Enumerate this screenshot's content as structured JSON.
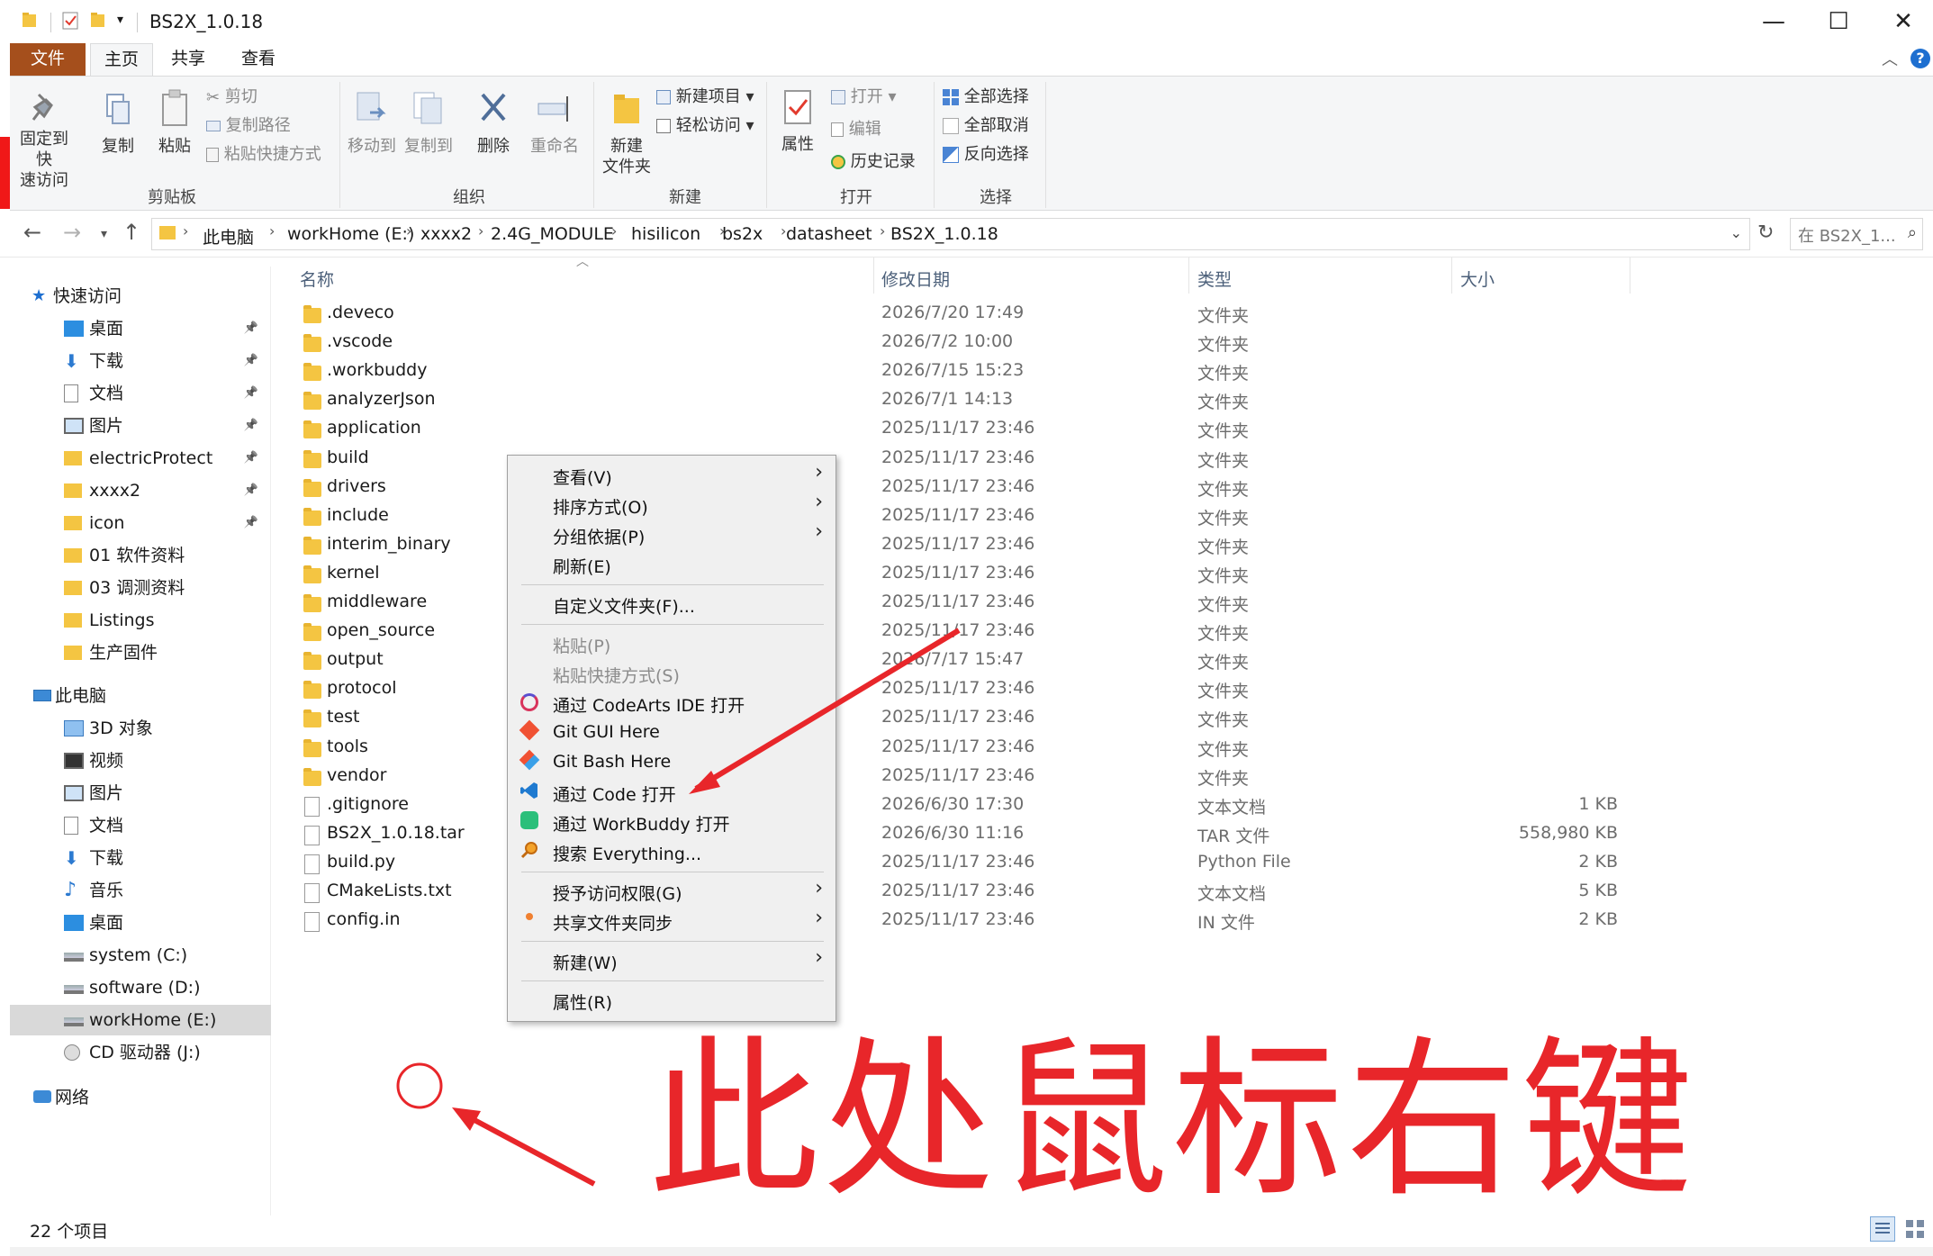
{
  "window": {
    "title": "BS2X_1.0.18",
    "minimize": "—",
    "maximize": "☐",
    "close": "✕"
  },
  "tabs": [
    {
      "label": "文件"
    },
    {
      "label": "主页"
    },
    {
      "label": "共享"
    },
    {
      "label": "查看"
    }
  ],
  "ribbon": {
    "clipboard": {
      "pin_label_1": "固定到快",
      "pin_label_2": "速访问",
      "copy": "复制",
      "paste": "粘贴",
      "cut": "剪切",
      "copy_path": "复制路径",
      "paste_shortcut": "粘贴快捷方式",
      "group": "剪贴板"
    },
    "organize": {
      "move_to": "移动到",
      "copy_to": "复制到",
      "delete": "删除",
      "rename": "重命名",
      "group": "组织"
    },
    "new": {
      "new_folder_1": "新建",
      "new_folder_2": "文件夹",
      "new_item": "新建项目 ▾",
      "easy_access": "轻松访问 ▾",
      "group": "新建"
    },
    "open": {
      "properties": "属性",
      "open": "打开 ▾",
      "edit": "编辑",
      "history": "历史记录",
      "group": "打开"
    },
    "select": {
      "select_all": "全部选择",
      "select_none": "全部取消",
      "invert": "反向选择",
      "group": "选择"
    }
  },
  "address": {
    "crumbs": [
      "此电脑",
      "workHome (E:)",
      "xxxx2",
      "2.4G_MODULE",
      "hisilicon",
      "bs2x",
      "datasheet",
      "BS2X_1.0.18"
    ],
    "search_placeholder": "在 BS2X_1..."
  },
  "sidebar": {
    "quick_access": "快速访问",
    "quick_items": [
      "桌面",
      "下载",
      "文档",
      "图片",
      "electricProtect",
      "xxxx2",
      "icon",
      "01 软件资料",
      "03 调测资料",
      "Listings",
      "生产固件"
    ],
    "this_pc": "此电脑",
    "pc_items": [
      "3D 对象",
      "视频",
      "图片",
      "文档",
      "下载",
      "音乐",
      "桌面",
      "system (C:)",
      "software (D:)",
      "workHome (E:)",
      "CD 驱动器 (J:)"
    ],
    "network": "网络"
  },
  "columns": {
    "name": "名称",
    "date": "修改日期",
    "type": "类型",
    "size": "大小"
  },
  "files": [
    {
      "name": ".deveco",
      "date": "2026/7/20 17:49",
      "type": "文件夹",
      "size": "",
      "kind": "folder"
    },
    {
      "name": ".vscode",
      "date": "2026/7/2 10:00",
      "type": "文件夹",
      "size": "",
      "kind": "folder"
    },
    {
      "name": ".workbuddy",
      "date": "2026/7/15 15:23",
      "type": "文件夹",
      "size": "",
      "kind": "folder"
    },
    {
      "name": "analyzerJson",
      "date": "2026/7/1 14:13",
      "type": "文件夹",
      "size": "",
      "kind": "folder"
    },
    {
      "name": "application",
      "date": "2025/11/17 23:46",
      "type": "文件夹",
      "size": "",
      "kind": "folder"
    },
    {
      "name": "build",
      "date": "2025/11/17 23:46",
      "type": "文件夹",
      "size": "",
      "kind": "folder"
    },
    {
      "name": "drivers",
      "date": "2025/11/17 23:46",
      "type": "文件夹",
      "size": "",
      "kind": "folder"
    },
    {
      "name": "include",
      "date": "2025/11/17 23:46",
      "type": "文件夹",
      "size": "",
      "kind": "folder"
    },
    {
      "name": "interim_binary",
      "date": "2025/11/17 23:46",
      "type": "文件夹",
      "size": "",
      "kind": "folder"
    },
    {
      "name": "kernel",
      "date": "2025/11/17 23:46",
      "type": "文件夹",
      "size": "",
      "kind": "folder"
    },
    {
      "name": "middleware",
      "date": "2025/11/17 23:46",
      "type": "文件夹",
      "size": "",
      "kind": "folder"
    },
    {
      "name": "open_source",
      "date": "2025/11/17 23:46",
      "type": "文件夹",
      "size": "",
      "kind": "folder"
    },
    {
      "name": "output",
      "date": "2026/7/17 15:47",
      "type": "文件夹",
      "size": "",
      "kind": "folder"
    },
    {
      "name": "protocol",
      "date": "2025/11/17 23:46",
      "type": "文件夹",
      "size": "",
      "kind": "folder"
    },
    {
      "name": "test",
      "date": "2025/11/17 23:46",
      "type": "文件夹",
      "size": "",
      "kind": "folder"
    },
    {
      "name": "tools",
      "date": "2025/11/17 23:46",
      "type": "文件夹",
      "size": "",
      "kind": "folder"
    },
    {
      "name": "vendor",
      "date": "2025/11/17 23:46",
      "type": "文件夹",
      "size": "",
      "kind": "folder"
    },
    {
      "name": ".gitignore",
      "date": "2026/6/30 17:30",
      "type": "文本文档",
      "size": "1 KB",
      "kind": "file"
    },
    {
      "name": "BS2X_1.0.18.tar",
      "date": "2026/6/30 11:16",
      "type": "TAR 文件",
      "size": "558,980 KB",
      "kind": "file"
    },
    {
      "name": "build.py",
      "date": "2025/11/17 23:46",
      "type": "Python File",
      "size": "2 KB",
      "kind": "file"
    },
    {
      "name": "CMakeLists.txt",
      "date": "2025/11/17 23:46",
      "type": "文本文档",
      "size": "5 KB",
      "kind": "file"
    },
    {
      "name": "config.in",
      "date": "2025/11/17 23:46",
      "type": "IN 文件",
      "size": "2 KB",
      "kind": "file"
    }
  ],
  "context_menu": {
    "view": "查看(V)",
    "sort": "排序方式(O)",
    "group": "分组依据(P)",
    "refresh": "刷新(E)",
    "customize": "自定义文件夹(F)...",
    "paste": "粘贴(P)",
    "paste_shortcut": "粘贴快捷方式(S)",
    "codearts": "通过 CodeArts IDE 打开",
    "git_gui": "Git GUI Here",
    "git_bash": "Git Bash Here",
    "vscode": "通过 Code 打开",
    "workbuddy": "通过 WorkBuddy 打开",
    "everything": "搜索 Everything...",
    "grant": "授予访问权限(G)",
    "sync": "共享文件夹同步",
    "new": "新建(W)",
    "properties": "属性(R)"
  },
  "status": {
    "count": "22 个项目"
  },
  "annotation": {
    "text": "此处鼠标右键",
    "color": "#e8262a"
  }
}
